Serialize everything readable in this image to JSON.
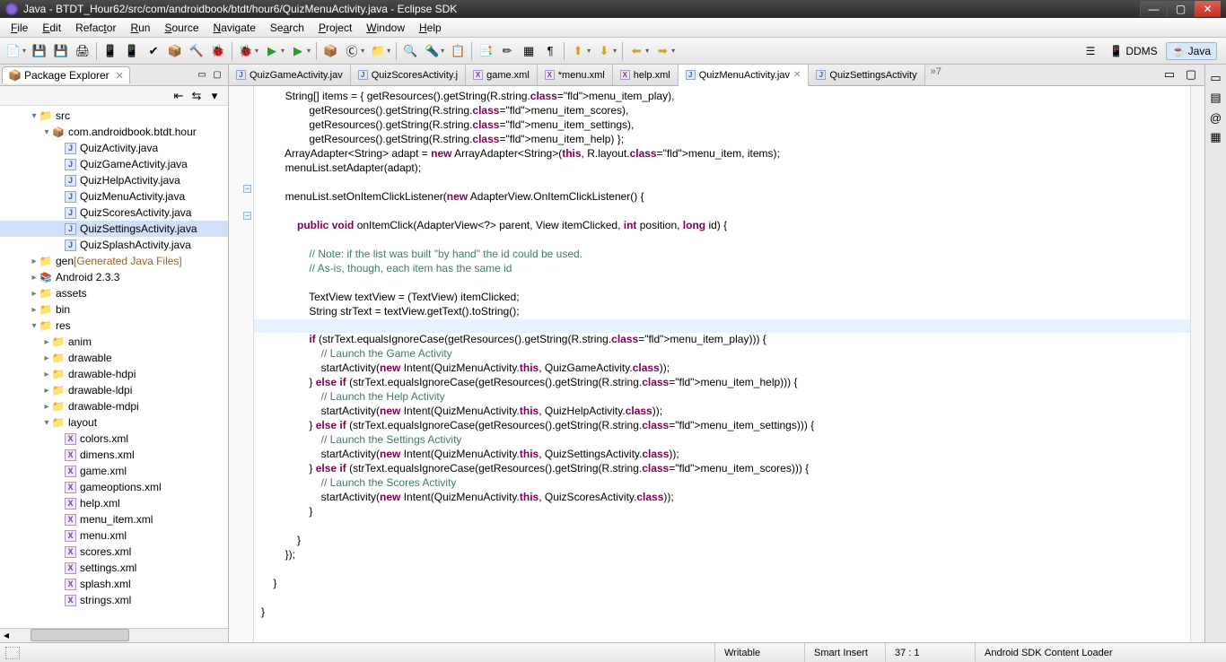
{
  "window": {
    "title": "Java - BTDT_Hour62/src/com/androidbook/btdt/hour6/QuizMenuActivity.java - Eclipse SDK"
  },
  "menu": {
    "file": "File",
    "edit": "Edit",
    "refactor": "Refactor",
    "run": "Run",
    "source": "Source",
    "navigate": "Navigate",
    "search": "Search",
    "project": "Project",
    "window": "Window",
    "help": "Help"
  },
  "perspectives": {
    "ddms": "DDMS",
    "java": "Java",
    "open": "Open Perspective"
  },
  "package_explorer": {
    "title": "Package Explorer",
    "src": "src",
    "package": "com.androidbook.btdt.hour",
    "java_files": [
      "QuizActivity.java",
      "QuizGameActivity.java",
      "QuizHelpActivity.java",
      "QuizMenuActivity.java",
      "QuizScoresActivity.java",
      "QuizSettingsActivity.java",
      "QuizSplashActivity.java"
    ],
    "gen": "gen",
    "gen_decor": "[Generated Java Files]",
    "android": "Android 2.3.3",
    "assets": "assets",
    "bin": "bin",
    "res": "res",
    "res_folders": [
      "anim",
      "drawable",
      "drawable-hdpi",
      "drawable-ldpi",
      "drawable-mdpi",
      "layout"
    ],
    "layout_files": [
      "colors.xml",
      "dimens.xml",
      "game.xml",
      "gameoptions.xml",
      "help.xml",
      "menu_item.xml",
      "menu.xml",
      "scores.xml",
      "settings.xml",
      "splash.xml",
      "strings.xml"
    ]
  },
  "editor_tabs": [
    {
      "label": "QuizGameActivity.jav",
      "type": "java"
    },
    {
      "label": "QuizScoresActivity.j",
      "type": "java"
    },
    {
      "label": "game.xml",
      "type": "xml"
    },
    {
      "label": "*menu.xml",
      "type": "xml"
    },
    {
      "label": "help.xml",
      "type": "xml"
    },
    {
      "label": "QuizMenuActivity.jav",
      "type": "java",
      "active": true
    },
    {
      "label": "QuizSettingsActivity",
      "type": "java"
    }
  ],
  "editor_overflow": "»7",
  "code_lines": [
    "        String[] items = { getResources().getString(R.string.menu_item_play),",
    "                getResources().getString(R.string.menu_item_scores),",
    "                getResources().getString(R.string.menu_item_settings),",
    "                getResources().getString(R.string.menu_item_help) };",
    "        ArrayAdapter<String> adapt = new ArrayAdapter<String>(this, R.layout.menu_item, items);",
    "        menuList.setAdapter(adapt);",
    "",
    "        menuList.setOnItemClickListener(new AdapterView.OnItemClickListener() {",
    "",
    "            public void onItemClick(AdapterView<?> parent, View itemClicked, int position, long id) {",
    "",
    "                // Note: if the list was built \"by hand\" the id could be used.",
    "                // As-is, though, each item has the same id",
    "",
    "                TextView textView = (TextView) itemClicked;",
    "                String strText = textView.getText().toString();",
    "",
    "                if (strText.equalsIgnoreCase(getResources().getString(R.string.menu_item_play))) {",
    "                    // Launch the Game Activity",
    "                    startActivity(new Intent(QuizMenuActivity.this, QuizGameActivity.class));",
    "                } else if (strText.equalsIgnoreCase(getResources().getString(R.string.menu_item_help))) {",
    "                    // Launch the Help Activity",
    "                    startActivity(new Intent(QuizMenuActivity.this, QuizHelpActivity.class));",
    "                } else if (strText.equalsIgnoreCase(getResources().getString(R.string.menu_item_settings))) {",
    "                    // Launch the Settings Activity",
    "                    startActivity(new Intent(QuizMenuActivity.this, QuizSettingsActivity.class));",
    "                } else if (strText.equalsIgnoreCase(getResources().getString(R.string.menu_item_scores))) {",
    "                    // Launch the Scores Activity",
    "                    startActivity(new Intent(QuizMenuActivity.this, QuizScoresActivity.class));",
    "                }",
    "",
    "            }",
    "        });",
    "",
    "    }",
    "",
    "}"
  ],
  "status": {
    "writable": "Writable",
    "insert": "Smart Insert",
    "pos": "37 : 1",
    "loader": "Android SDK Content Loader"
  }
}
